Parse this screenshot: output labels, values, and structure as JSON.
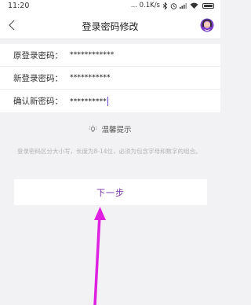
{
  "status_bar": {
    "time": "11:20",
    "network_speed": "... 0.1K/s",
    "icons": [
      "bluetooth-icon",
      "alarm-icon",
      "signal-icon",
      "wifi-icon",
      "battery-icon"
    ]
  },
  "nav": {
    "title": "登录密码修改",
    "back_icon": "chevron-left-icon",
    "service_icon": "customer-service-icon"
  },
  "form": {
    "rows": [
      {
        "label": "原登录密码：",
        "value": "************"
      },
      {
        "label": "新登录密码：",
        "value": "***********"
      },
      {
        "label": "确认新密码：",
        "value": "**********"
      }
    ]
  },
  "tips": {
    "title": "温馨提示",
    "icon": "lightbulb-icon",
    "text": "登录密码区分大小写，长度为8-14位，必须为包含字母和数字的组合。"
  },
  "next_button": {
    "label": "下一步"
  },
  "colors": {
    "accent": "#7b2fa8",
    "annotation_arrow": "#e020e0",
    "background": "#f2f2f4"
  }
}
